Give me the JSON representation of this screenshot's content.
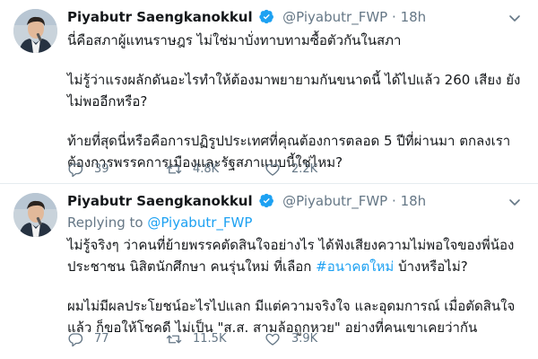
{
  "tweets": [
    {
      "name": "Piyabutr Saengkanokkul",
      "handle": "@Piyabutr_FWP",
      "dot": "·",
      "time": "18h",
      "replying_prefix": "",
      "replying_mention": "",
      "lines": [
        "นี่คือสภาผู้แทนราษฎร ไม่ใช่มาบั่งทาบทามซื้อตัวกันในสภา",
        "ไม่รู้ว่าแรงผลักดันอะไรทำให้ต้องมาพยายามกันขนาดนี้ ได้ไปแล้ว 260 เสียง ยังไม่พออีกหรือ?",
        "ท้ายที่สุดนี่หรือคือการปฏิรูปประเทศที่คุณต้องการตลอด 5 ปีที่ผ่านมา ตกลงเราต้องการพรรคการเมืองและรัฐสภาแบบนี้ใช่ไหม?"
      ],
      "replies": "39",
      "retweets": "4.8K",
      "likes": "2.2K"
    },
    {
      "name": "Piyabutr Saengkanokkul",
      "handle": "@Piyabutr_FWP",
      "dot": "·",
      "time": "18h",
      "replying_prefix": "Replying to ",
      "replying_mention": "@Piyabutr_FWP",
      "line1_pre": "ไม่รู้จริงๆ ว่าคนที่ย้ายพรรคตัดสินใจอย่างไร ได้ฟังเสียงความไม่พอใจของพี่น้องประชาชน นิสิตนักศึกษา คนรุ่นใหม่ ที่เลือก ",
      "hashtag": "#อนาคตใหม่",
      "line1_post": " บ้างหรือไม่?",
      "line2": "ผมไม่มีผลประโยชน์อะไรไปแลก มีแต่ความจริงใจ และอุดมการณ์ เมื่อตัดสินใจแล้ว ก็ขอให้โชคดี ไม่เป็น \"ส.ส. สามล้อถูกหวย\" อย่างที่คนเขาเคยว่ากัน",
      "replies": "77",
      "retweets": "11.5K",
      "likes": "3.9K"
    }
  ],
  "colors": {
    "link": "#1da1f2",
    "muted": "#657786",
    "text": "#14171a",
    "divider": "#e6ecf0"
  },
  "icons": [
    "avatar-photo",
    "verified-badge-icon",
    "chevron-down-icon",
    "reply-icon",
    "retweet-icon",
    "like-icon"
  ]
}
